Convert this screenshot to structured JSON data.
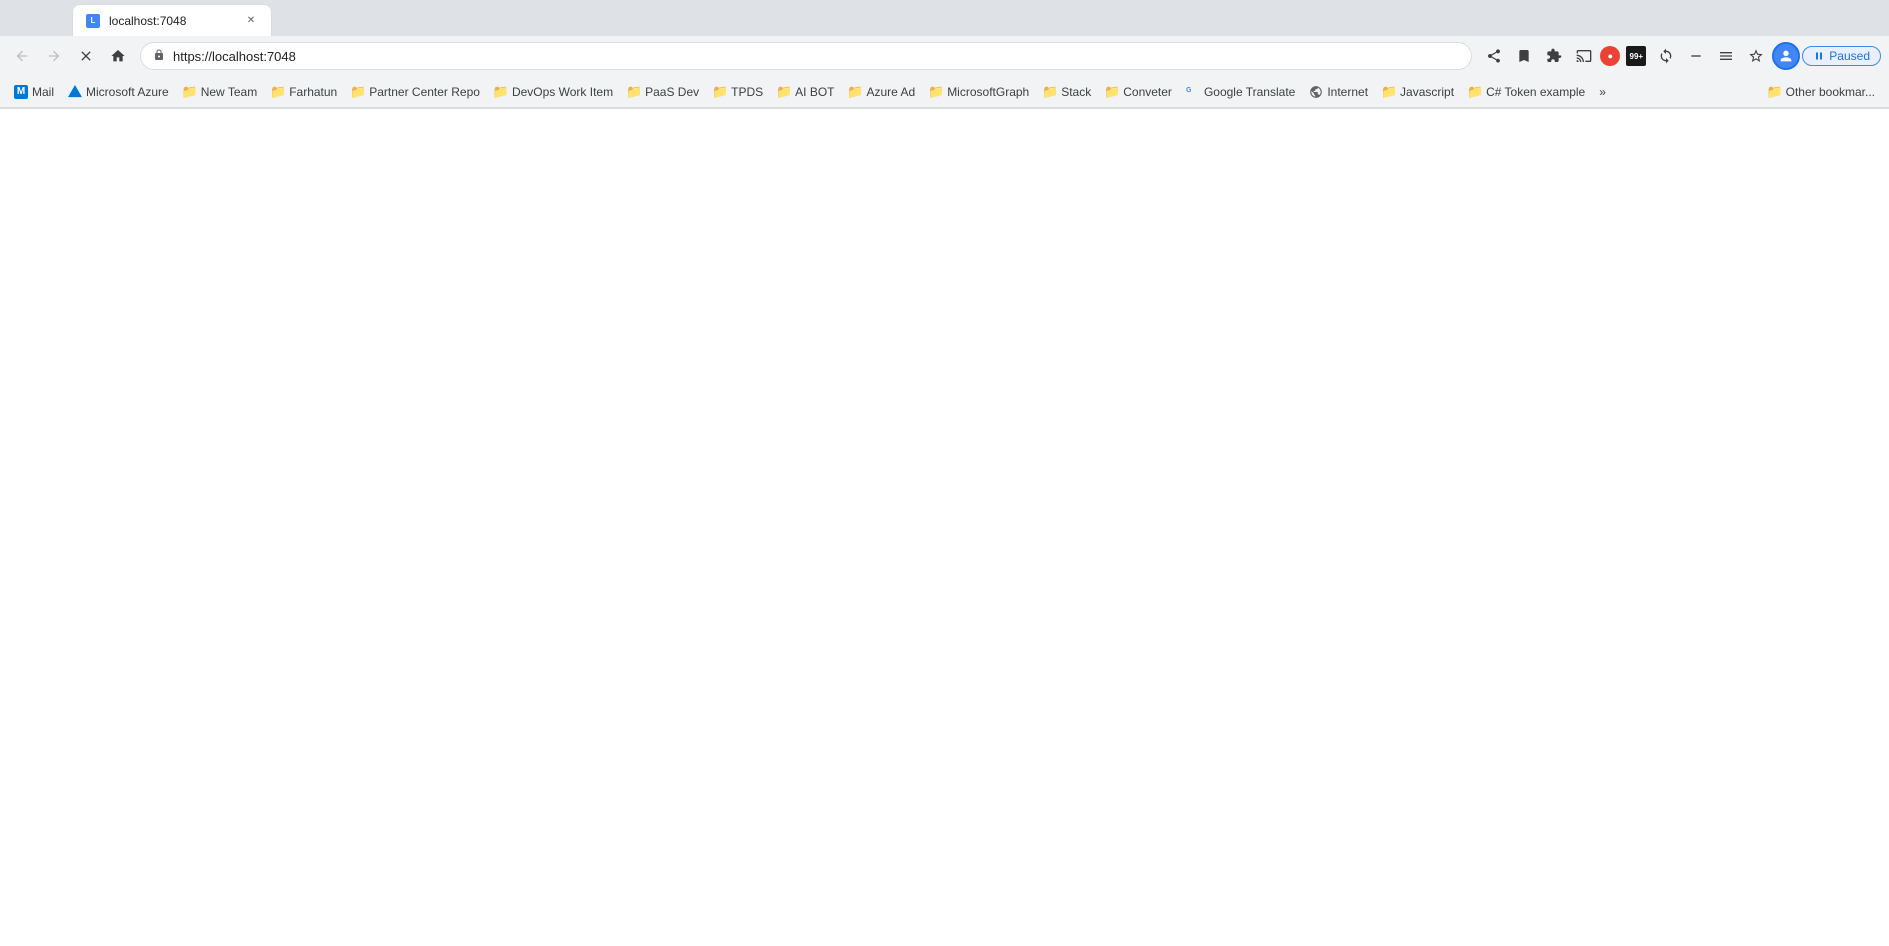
{
  "browser": {
    "url": "https://localhost:7048",
    "tab_title": "localhost:7048",
    "paused_label": "Paused"
  },
  "nav_buttons": {
    "back": "←",
    "forward": "→",
    "close": "✕",
    "home": "⌂",
    "share": "↗",
    "bookmark": "☆",
    "extensions": "🧩",
    "sidebar": "▤",
    "profile": "P",
    "overflow": "⋮"
  },
  "bookmarks": [
    {
      "id": "mail",
      "label": "Mail",
      "type": "favicon-outlook",
      "icon": "M"
    },
    {
      "id": "microsoft-azure",
      "label": "Microsoft Azure",
      "type": "favicon-azure",
      "icon": "A"
    },
    {
      "id": "new-team",
      "label": "New Team",
      "type": "folder",
      "icon": "📁"
    },
    {
      "id": "farhatun",
      "label": "Farhatun",
      "type": "folder",
      "icon": "📁"
    },
    {
      "id": "partner-center-repo",
      "label": "Partner Center Repo",
      "type": "folder",
      "icon": "📁"
    },
    {
      "id": "devops-work-item",
      "label": "DevOps Work Item",
      "type": "folder",
      "icon": "📁"
    },
    {
      "id": "paas-dev",
      "label": "PaaS Dev",
      "type": "folder",
      "icon": "📁"
    },
    {
      "id": "tpds",
      "label": "TPDS",
      "type": "folder",
      "icon": "📁"
    },
    {
      "id": "ai-bot",
      "label": "AI BOT",
      "type": "folder",
      "icon": "📁"
    },
    {
      "id": "azure-ad",
      "label": "Azure Ad",
      "type": "folder",
      "icon": "📁"
    },
    {
      "id": "microsoftgraph",
      "label": "MicrosoftGraph",
      "type": "folder",
      "icon": "📁"
    },
    {
      "id": "stack",
      "label": "Stack",
      "type": "folder",
      "icon": "📁"
    },
    {
      "id": "conveter",
      "label": "Conveter",
      "type": "folder",
      "icon": "📁"
    },
    {
      "id": "google-translate",
      "label": "Google Translate",
      "type": "favicon-google",
      "icon": "G"
    },
    {
      "id": "internet",
      "label": "Internet",
      "type": "favicon-globe",
      "icon": "🌐"
    },
    {
      "id": "javascript",
      "label": "Javascript",
      "type": "folder",
      "icon": "📁"
    },
    {
      "id": "csharp-token-example",
      "label": "C# Token example",
      "type": "folder",
      "icon": "📁"
    },
    {
      "id": "other-bookmarks",
      "label": "Other bookmar...",
      "type": "folder",
      "icon": "📁"
    }
  ],
  "extension_badge": "99+"
}
